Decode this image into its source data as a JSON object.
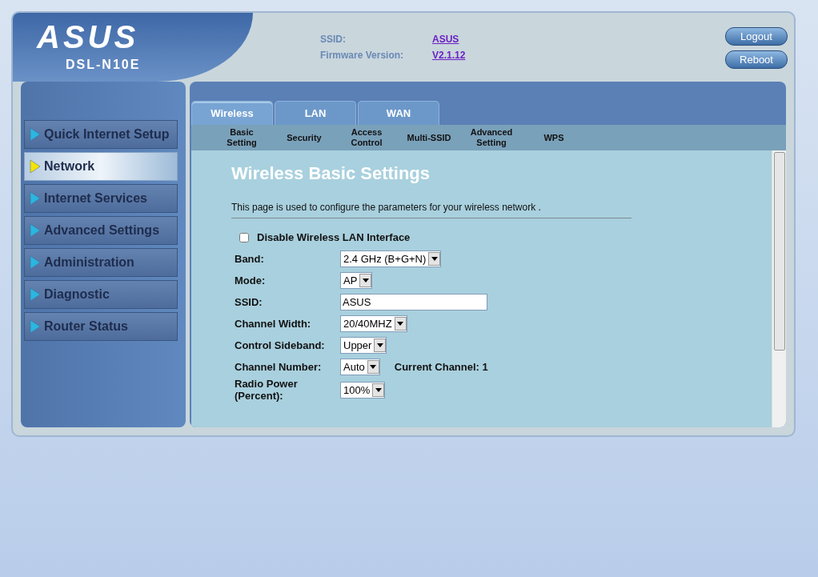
{
  "header": {
    "logo": "ASUS",
    "model": "DSL-N10E",
    "info": [
      {
        "label": "SSID:",
        "value": "ASUS"
      },
      {
        "label": "Firmware Version:",
        "value": "V2.1.12"
      }
    ],
    "buttons": [
      "Logout",
      "Reboot"
    ]
  },
  "sidebar": {
    "items": [
      {
        "label": "Quick Internet Setup",
        "selected": false
      },
      {
        "label": "Network",
        "selected": true
      },
      {
        "label": "Internet Services",
        "selected": false
      },
      {
        "label": "Advanced Settings",
        "selected": false
      },
      {
        "label": "Administration",
        "selected": false
      },
      {
        "label": "Diagnostic",
        "selected": false
      },
      {
        "label": "Router Status",
        "selected": false
      }
    ]
  },
  "tabs": [
    {
      "label": "Wireless",
      "selected": true
    },
    {
      "label": "LAN",
      "selected": false
    },
    {
      "label": "WAN",
      "selected": false
    }
  ],
  "subtabs": [
    "Basic Setting",
    "Security",
    "Access Control",
    "Multi-SSID",
    "Advanced Setting",
    "WPS"
  ],
  "content": {
    "title": "Wireless Basic Settings",
    "description": "This page is used to configure the parameters for your wireless network .",
    "disable_checkbox": {
      "label": "Disable Wireless LAN Interface",
      "checked": false
    },
    "fields": [
      {
        "kind": "select",
        "label": "Band:",
        "value": "2.4 GHz (B+G+N)"
      },
      {
        "kind": "select",
        "label": "Mode:",
        "value": "AP"
      },
      {
        "kind": "text",
        "label": "SSID:",
        "value": "ASUS"
      },
      {
        "kind": "select",
        "label": "Channel Width:",
        "value": "20/40MHZ"
      },
      {
        "kind": "select",
        "label": "Control Sideband:",
        "value": "Upper"
      },
      {
        "kind": "select",
        "label": "Channel Number:",
        "value": "Auto",
        "note": "Current Channel: 1"
      },
      {
        "kind": "select",
        "label": "Radio Power (Percent):",
        "value": "100%"
      }
    ]
  }
}
